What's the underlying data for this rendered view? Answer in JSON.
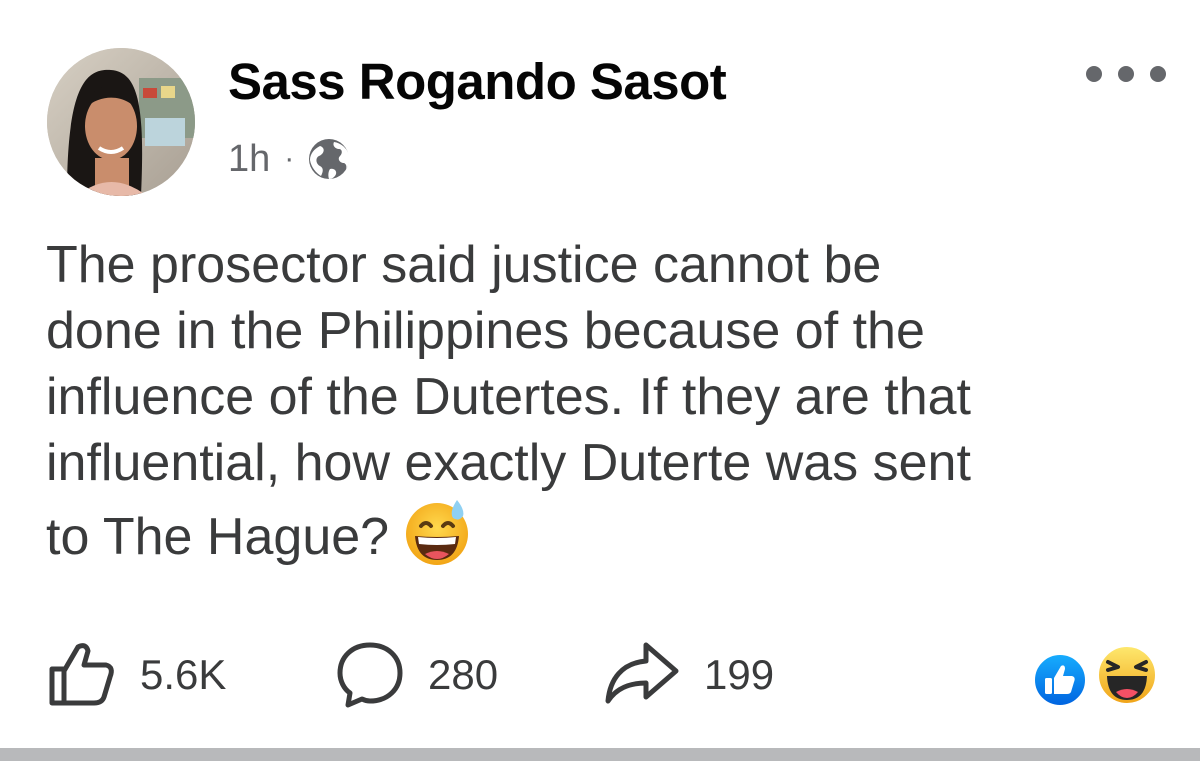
{
  "post": {
    "author_name": "Sass Rogando Sasot",
    "timestamp": "1h",
    "separator": "·",
    "audience_icon": "globe-icon",
    "more_icon": "more-options-icon",
    "text_lines": [
      "The prosector said justice cannot be",
      "done in the Philippines because of the",
      "influence of the Dutertes. If they are that",
      "influential, how exactly Duterte was sent",
      "to The Hague?"
    ],
    "inline_emoji": "grinning-face-with-sweat-emoji"
  },
  "actions": {
    "like": {
      "icon": "thumbs-up-icon",
      "count": "5.6K"
    },
    "comment": {
      "icon": "comment-bubble-icon",
      "count": "280"
    },
    "share": {
      "icon": "share-arrow-icon",
      "count": "199"
    }
  },
  "reactions": [
    "like-reaction-icon",
    "haha-reaction-icon"
  ],
  "colors": {
    "text_primary": "#050505",
    "text_body": "#3a3b3c",
    "text_secondary": "#65676b",
    "like_blue": "#1877f2",
    "emoji_yellow": "#f7c33c"
  }
}
